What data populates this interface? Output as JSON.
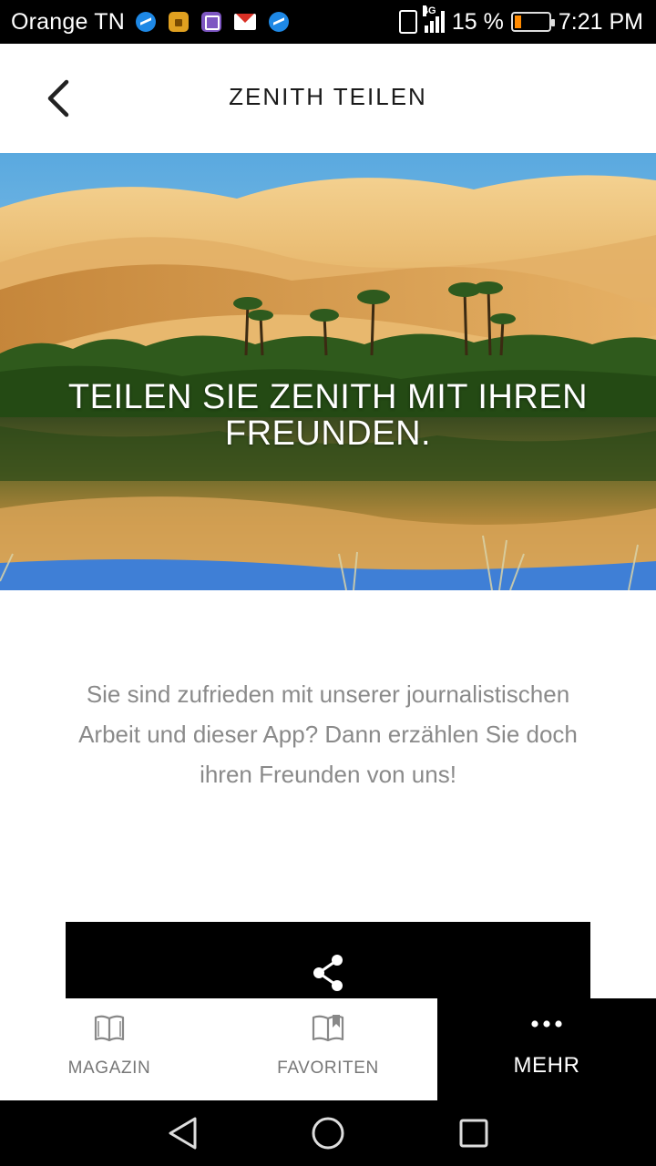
{
  "status_bar": {
    "carrier": "Orange TN",
    "network": "4G",
    "battery_percent": "15 %",
    "time": "7:21 PM",
    "notification_icons": [
      "messenger-icon",
      "lock-icon",
      "gallery-icon",
      "gmail-icon",
      "messenger-icon"
    ]
  },
  "header": {
    "title": "ZENITH TEILEN",
    "back_icon": "chevron-left-icon"
  },
  "hero": {
    "headline": "TEILEN SIE ZENITH MIT IHREN FREUNDEN.",
    "image": "desert oasis with palm trees reflected in water"
  },
  "body": {
    "description": "Sie sind zufrieden mit unserer journalistischen Arbeit und dieser App? Dann erzählen Sie doch ihren Freunden von uns!"
  },
  "share_button": {
    "icon": "share-icon"
  },
  "bottom_nav": {
    "items": [
      {
        "label": "MAGAZIN",
        "icon": "open-book-icon",
        "active": false
      },
      {
        "label": "FAVORITEN",
        "icon": "bookmark-book-icon",
        "active": false
      },
      {
        "label": "MEHR",
        "icon": "more-dots-icon",
        "active": true
      }
    ]
  },
  "system_nav": {
    "buttons": [
      "back-triangle-icon",
      "home-circle-icon",
      "recents-square-icon"
    ]
  },
  "colors": {
    "background": "#ffffff",
    "accent_dark": "#000000",
    "muted_text": "#8a8a8a",
    "title_text": "#1a1a1a"
  }
}
